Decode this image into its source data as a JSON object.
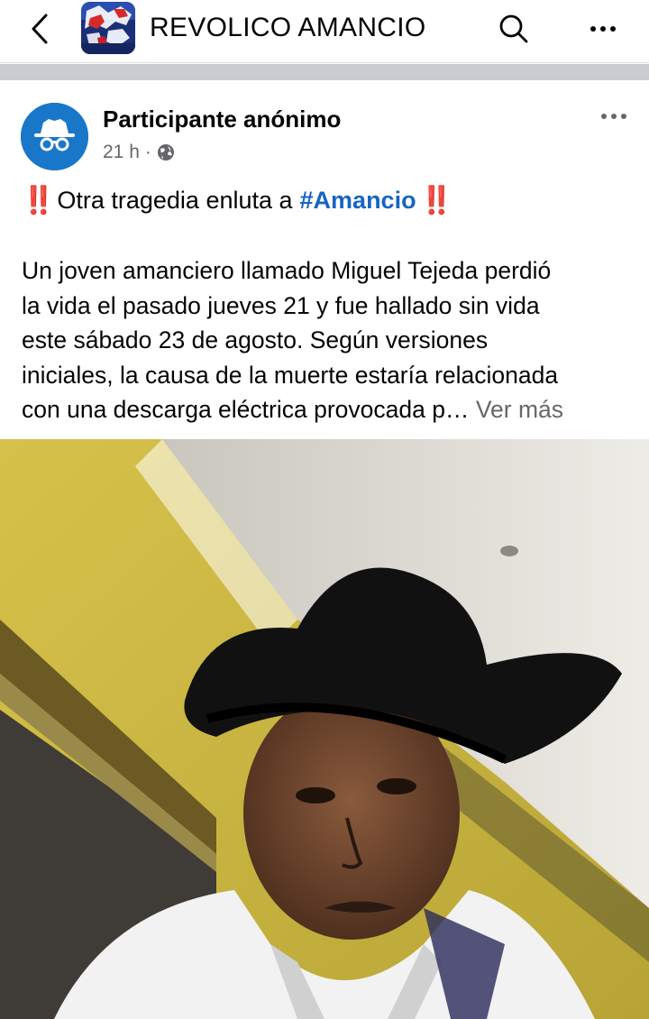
{
  "header": {
    "group_name": "REVOLICO AMANCIO",
    "back_icon": "chevron-left-icon",
    "search_icon": "search-icon",
    "more_icon": "more-horizontal-icon"
  },
  "post": {
    "author": "Participante anónimo",
    "time": "21 h",
    "separator": "·",
    "audience_icon": "globe-icon",
    "headline": {
      "prefix_emoji": "‼️",
      "text": "Otra tragedia enluta a",
      "hashtag": "#Amancio",
      "suffix_emoji": "‼️"
    },
    "body_lines": [
      "Un joven amanciero llamado Miguel Tejeda perdió",
      "la vida el pasado jueves 21 y fue hallado sin vida",
      "este sábado 23 de agosto. Según versiones",
      "iniciales, la causa de la muerte estaría relacionada",
      "con una descarga eléctrica provocada p…"
    ],
    "see_more": "Ver más",
    "photo_description_icon": "photo-icon"
  },
  "colors": {
    "hashtag": "#1764c5",
    "avatar_bg": "#1877c8",
    "meta_text": "#65676b",
    "emoji_red": "#e0212a",
    "divider": "#c9ccd1"
  }
}
